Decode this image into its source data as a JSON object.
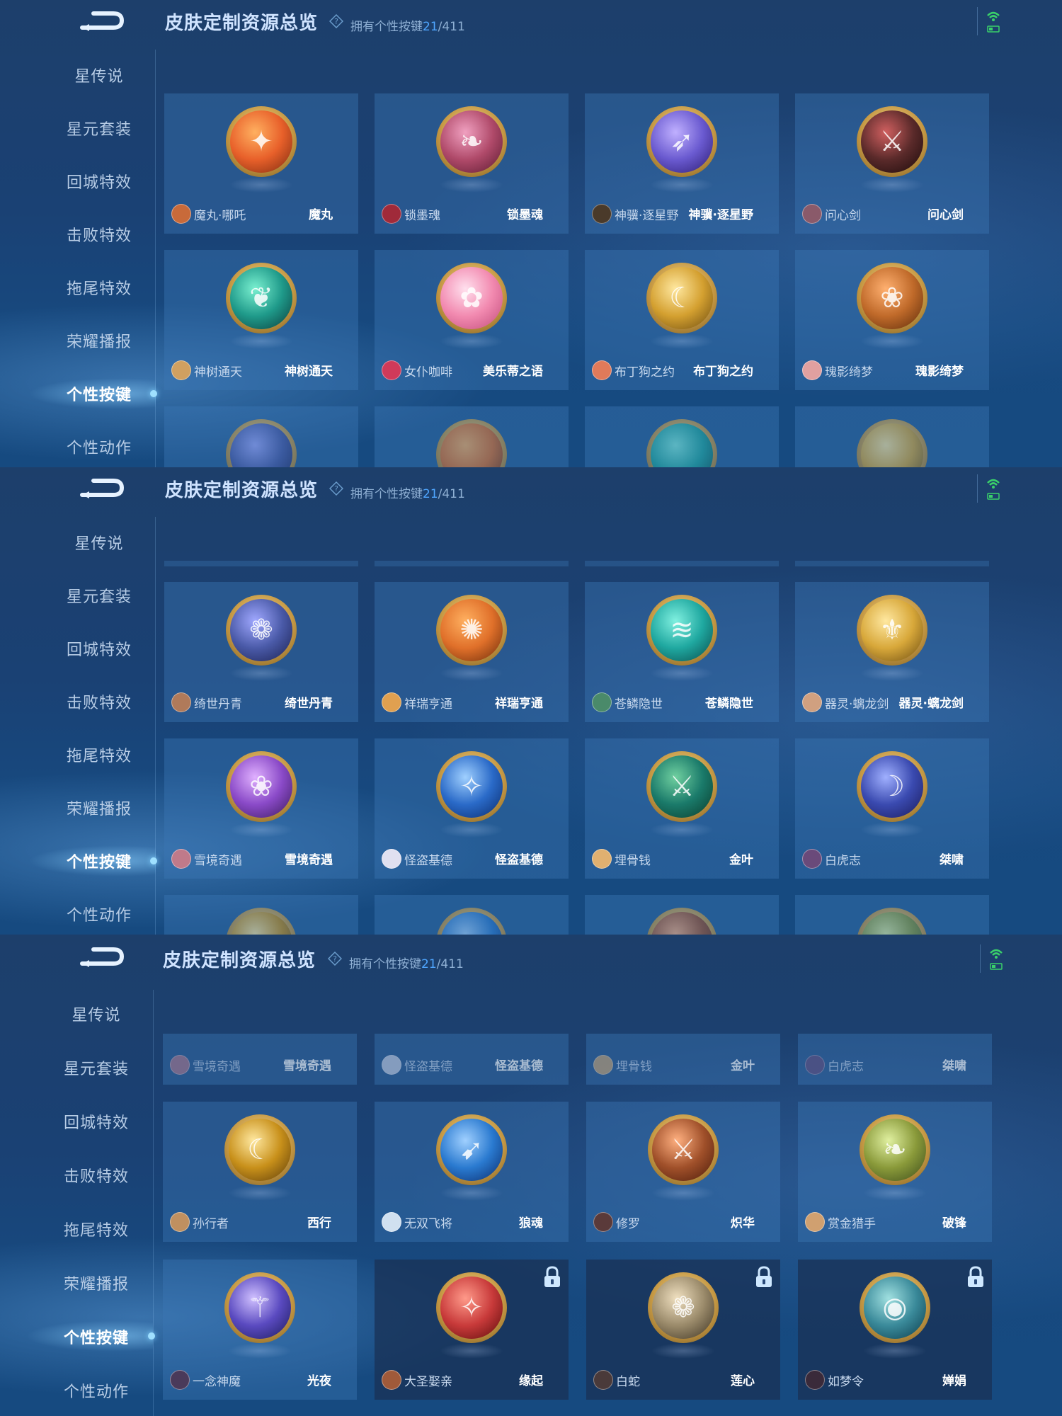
{
  "header": {
    "title": "皮肤定制资源总览",
    "owned_label": "拥有个性按键",
    "owned_count": "21",
    "owned_total": "/411"
  },
  "sidebar": {
    "items": [
      {
        "label": "星传说"
      },
      {
        "label": "星元套装"
      },
      {
        "label": "回城特效"
      },
      {
        "label": "击败特效"
      },
      {
        "label": "拖尾特效"
      },
      {
        "label": "荣耀播报"
      },
      {
        "label": "个性按键",
        "active": true
      },
      {
        "label": "个性动作"
      }
    ]
  },
  "screen1": {
    "cards": [
      {
        "hero": "魔丸·哪吒",
        "skin": "魔丸",
        "color": "#e8602a"
      },
      {
        "hero": "锁墨魂",
        "skin": "锁墨魂",
        "color": "#b04a6a"
      },
      {
        "hero": "神骥·逐星野",
        "skin": "神骥·逐星野",
        "color": "#6a5ad0"
      },
      {
        "hero": "问心剑",
        "skin": "问心剑",
        "color": "#5a2a2a"
      },
      {
        "hero": "神树通天",
        "skin": "神树通天",
        "color": "#1f9a8a"
      },
      {
        "hero": "女仆咖啡",
        "skin": "美乐蒂之语",
        "color": "#f28ab0"
      },
      {
        "hero": "布丁狗之约",
        "skin": "布丁狗之约",
        "color": "#d4a030"
      },
      {
        "hero": "瑰影绮梦",
        "skin": "瑰影绮梦",
        "color": "#c06a2a"
      }
    ]
  },
  "screen2": {
    "cards": [
      {
        "hero": "绮世丹青",
        "skin": "绮世丹青",
        "color": "#4a5aa8"
      },
      {
        "hero": "祥瑞亨通",
        "skin": "祥瑞亨通",
        "color": "#e0702a"
      },
      {
        "hero": "苍鳞隐世",
        "skin": "苍鳞隐世",
        "color": "#1fa8a0"
      },
      {
        "hero": "器灵·螭龙剑",
        "skin": "器灵·螭龙剑",
        "color": "#d8a83a"
      },
      {
        "hero": "雪境奇遇",
        "skin": "雪境奇遇",
        "color": "#8a4ac8"
      },
      {
        "hero": "怪盗基德",
        "skin": "怪盗基德",
        "color": "#2a6ac8"
      },
      {
        "hero": "埋骨钱",
        "skin": "金叶",
        "color": "#1a7a6a"
      },
      {
        "hero": "白虎志",
        "skin": "桀啸",
        "color": "#3a4ab0"
      }
    ]
  },
  "screen3": {
    "partial_cards": [
      {
        "hero": "雪境奇遇",
        "skin": "雪境奇遇"
      },
      {
        "hero": "怪盗基德",
        "skin": "怪盗基德"
      },
      {
        "hero": "埋骨钱",
        "skin": "金叶"
      },
      {
        "hero": "白虎志",
        "skin": "桀啸"
      }
    ],
    "cards": [
      {
        "hero": "孙行者",
        "skin": "西行",
        "color": "#c8901a"
      },
      {
        "hero": "无双飞将",
        "skin": "狼魂",
        "color": "#2a7ad0"
      },
      {
        "hero": "修罗",
        "skin": "炽华",
        "color": "#a0502a"
      },
      {
        "hero": "赏金猎手",
        "skin": "破锋",
        "color": "#8a9a3a"
      },
      {
        "hero": "一念神魔",
        "skin": "光夜",
        "color": "#5a4ac0",
        "locked": false
      },
      {
        "hero": "大圣娶亲",
        "skin": "缘起",
        "color": "#c83a3a",
        "locked": true
      },
      {
        "hero": "白蛇",
        "skin": "莲心",
        "color": "#9a8a6a",
        "locked": true
      },
      {
        "hero": "如梦令",
        "skin": "婵娟",
        "color": "#3a8a9a",
        "locked": true
      }
    ]
  },
  "icons": {
    "back": "back-arrow-icon",
    "info": "info-icon",
    "signal": "wifi-battery-icon",
    "lock": "lock-icon",
    "item": "button-skin-icon"
  }
}
